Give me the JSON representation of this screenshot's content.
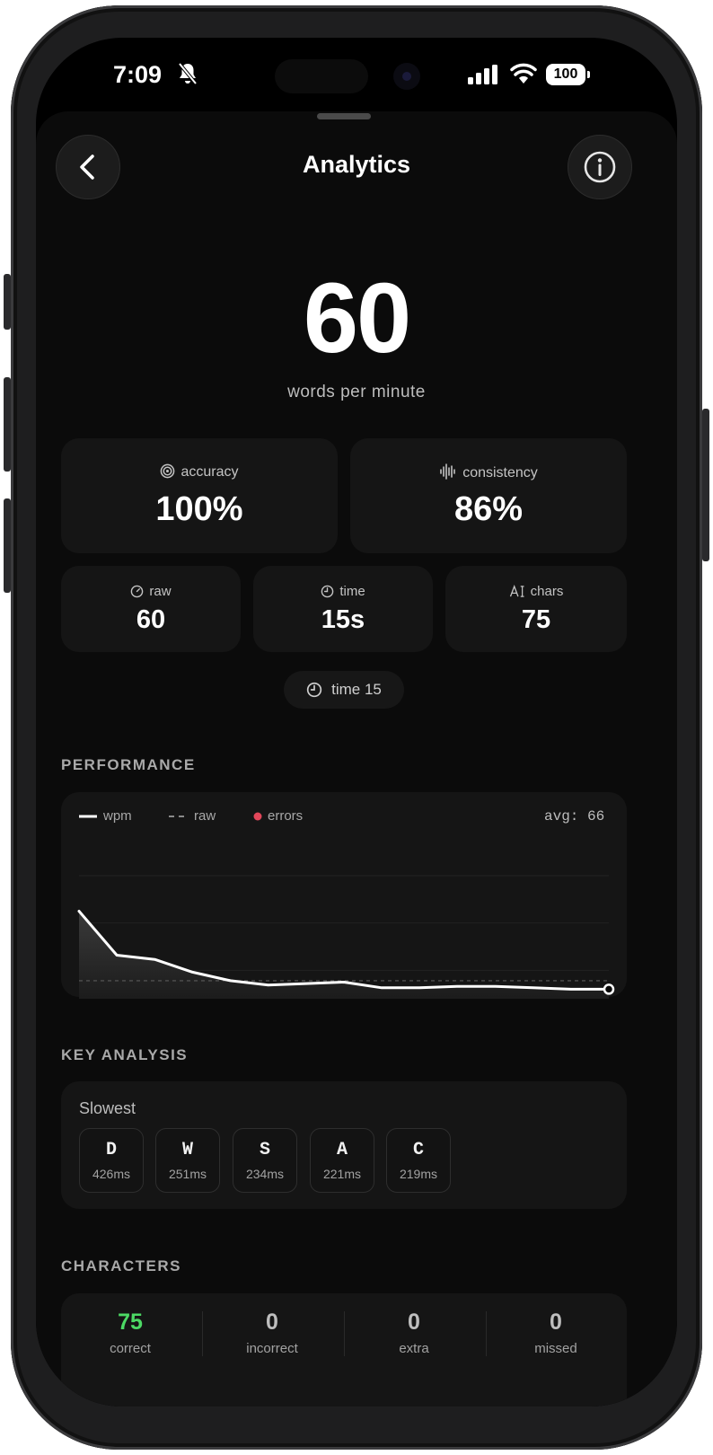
{
  "status_bar": {
    "time": "7:09",
    "battery": "100",
    "icons": [
      "bell-slash-icon",
      "signal-icon",
      "wifi-icon",
      "battery-icon"
    ]
  },
  "header": {
    "title": "Analytics",
    "back_icon": "chevron-left-icon",
    "info_icon": "info-icon"
  },
  "hero": {
    "wpm": "60",
    "label": "words per minute"
  },
  "stats_primary": [
    {
      "label": "accuracy",
      "value": "100%",
      "icon": "target-icon"
    },
    {
      "label": "consistency",
      "value": "86%",
      "icon": "waveform-icon"
    }
  ],
  "stats_secondary": [
    {
      "label": "raw",
      "value": "60",
      "icon": "gauge-icon"
    },
    {
      "label": "time",
      "value": "15s",
      "icon": "clock-icon"
    },
    {
      "label": "chars",
      "value": "75",
      "icon": "text-cursor-icon"
    }
  ],
  "mode_pill": {
    "label": "time 15",
    "icon": "clock-icon"
  },
  "performance": {
    "section_title": "PERFORMANCE",
    "legend": [
      "wpm",
      "raw",
      "errors"
    ],
    "avg_label": "avg: 66"
  },
  "chart_data": {
    "type": "line",
    "title": "",
    "xlabel": "",
    "ylabel": "",
    "x": [
      1,
      2,
      3,
      4,
      5,
      6,
      7,
      8,
      9,
      10,
      11,
      12,
      13,
      14,
      15
    ],
    "series": [
      {
        "name": "wpm",
        "values": [
          115,
          84,
          81,
          72,
          66,
          63,
          64,
          65,
          61,
          61,
          62,
          62,
          61,
          60,
          60
        ]
      }
    ],
    "ylim": [
      40,
      140
    ],
    "reference_lines": [
      {
        "label": "avg",
        "value": 66
      }
    ],
    "grid": true,
    "legend_position": "top-left"
  },
  "key_analysis": {
    "section_title": "KEY ANALYSIS",
    "subtitle": "Slowest",
    "keys": [
      {
        "key": "D",
        "time": "426ms"
      },
      {
        "key": "W",
        "time": "251ms"
      },
      {
        "key": "S",
        "time": "234ms"
      },
      {
        "key": "A",
        "time": "221ms"
      },
      {
        "key": "C",
        "time": "219ms"
      }
    ]
  },
  "characters": {
    "section_title": "CHARACTERS",
    "items": [
      {
        "value": "75",
        "label": "correct",
        "color": "#4cd964"
      },
      {
        "value": "0",
        "label": "incorrect",
        "color": "#bdbdbd"
      },
      {
        "value": "0",
        "label": "extra",
        "color": "#bdbdbd"
      },
      {
        "value": "0",
        "label": "missed",
        "color": "#bdbdbd"
      }
    ]
  }
}
